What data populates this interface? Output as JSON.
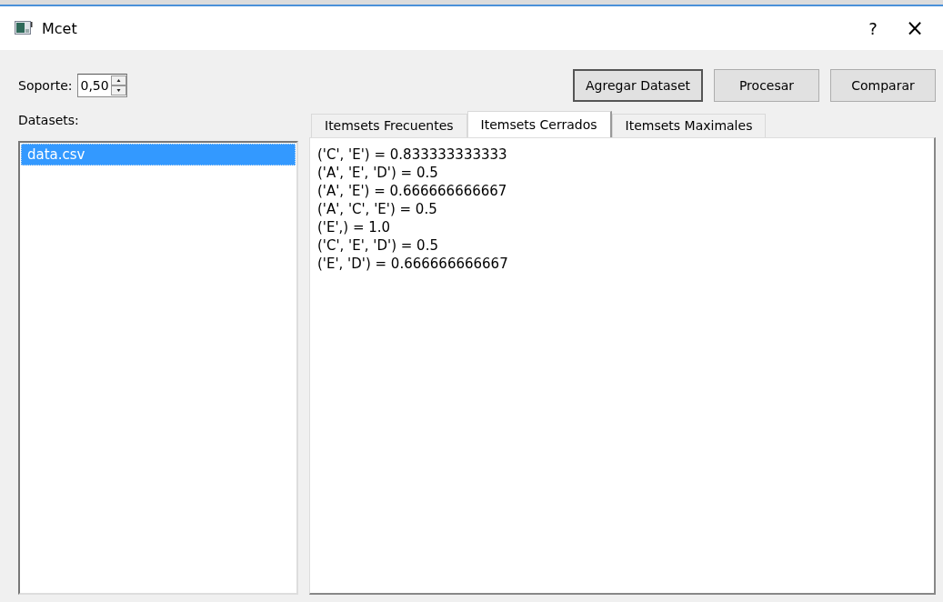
{
  "window": {
    "title": "Mcet"
  },
  "title_buttons": [
    "?",
    "×"
  ],
  "support": {
    "label": "Soporte:",
    "value": "0,50"
  },
  "buttons": [
    {
      "label": "Agregar Dataset",
      "focused": true
    },
    {
      "label": "Procesar",
      "focused": false
    },
    {
      "label": "Comparar",
      "focused": false
    }
  ],
  "datasets": {
    "label": "Datasets:",
    "items": [
      {
        "name": "data.csv",
        "selected": true
      }
    ]
  },
  "tabs": [
    {
      "label": "Itemsets Frecuentes",
      "selected": false
    },
    {
      "label": "Itemsets Cerrados",
      "selected": true
    },
    {
      "label": "Itemsets  Maximales",
      "selected": false
    }
  ],
  "output_lines": [
    "('C', 'E') = 0.833333333333",
    "('A', 'E', 'D') = 0.5",
    "('A', 'E') = 0.666666666667",
    "('A', 'C', 'E') = 0.5",
    "('E',) = 1.0",
    "('C', 'E', 'D') = 0.5",
    "('E', 'D') = 0.666666666667"
  ]
}
